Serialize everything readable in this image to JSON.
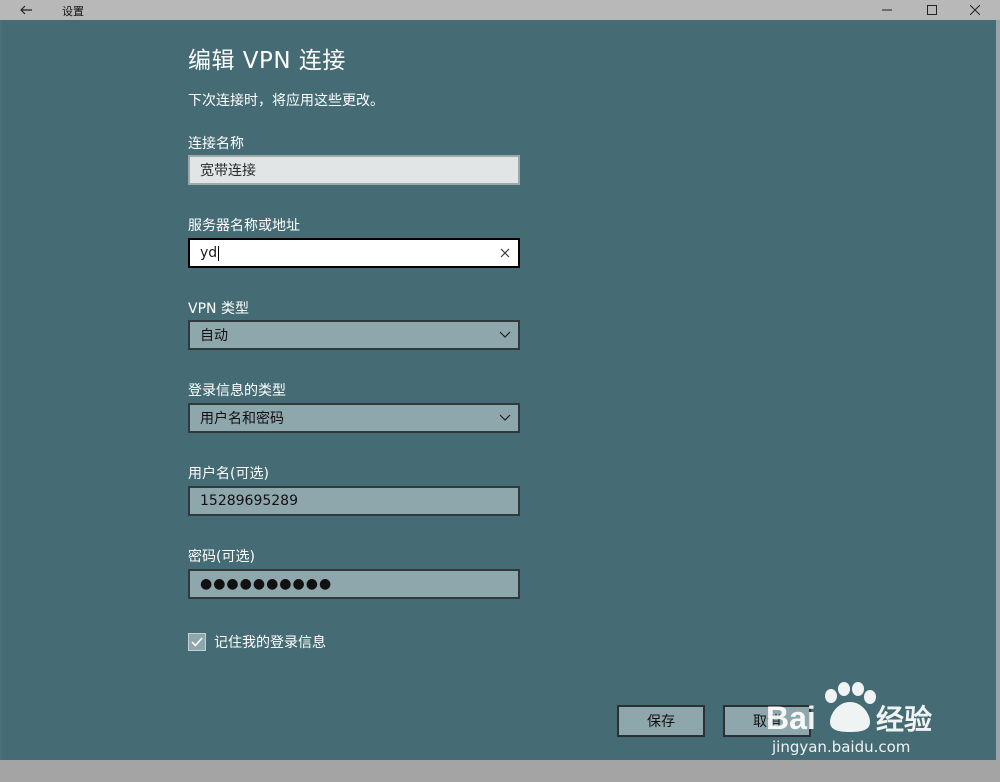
{
  "titlebar": {
    "title": "设置"
  },
  "form": {
    "heading": "编辑 VPN 连接",
    "subtext": "下次连接时，将应用这些更改。",
    "connection_name": {
      "label": "连接名称",
      "value": "宽带连接"
    },
    "server": {
      "label": "服务器名称或地址",
      "value": "yd"
    },
    "vpn_type": {
      "label": "VPN 类型",
      "selected": "自动"
    },
    "signin_type": {
      "label": "登录信息的类型",
      "selected": "用户名和密码"
    },
    "username": {
      "label": "用户名(可选)",
      "value": "15289695289"
    },
    "password": {
      "label": "密码(可选)",
      "masked": "●●●●●●●●●●"
    },
    "remember": {
      "label": "记住我的登录信息",
      "checked": true
    }
  },
  "buttons": {
    "save": "保存",
    "cancel": "取消"
  },
  "watermark": {
    "brand_text": "Baidu经验",
    "url": "jingyan.baidu.com"
  },
  "colors": {
    "background": "#456b75",
    "field_dim": "#8ea7ad",
    "titlebar": "#b8b8b8"
  }
}
